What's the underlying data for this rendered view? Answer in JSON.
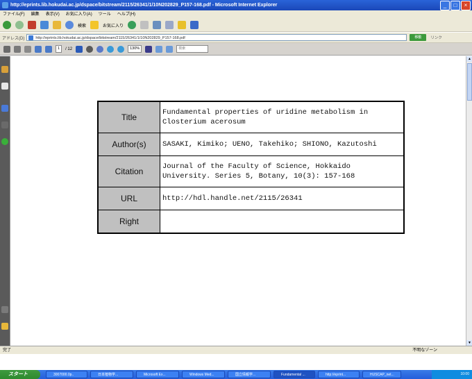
{
  "window": {
    "title": "http://eprints.lib.hokudai.ac.jp/dspace/bitstream/2115/26341/1/10N202829_P157-168.pdf - Microsoft Internet Explorer"
  },
  "menu": [
    "ファイル(F)",
    "編集",
    "表示(V)",
    "お気に入り(A)",
    "ツール",
    "ヘルプ(H)"
  ],
  "toolbar": {
    "search_label": "検索",
    "favorites_label": "お気に入り"
  },
  "address": {
    "label": "アドレス(D)",
    "url": "http://eprints.lib.hokudai.ac.jp/dspace/bitstream/2115/26341/1/10N202829_P157-168.pdf",
    "go_label": "移動",
    "links_label": "リンク"
  },
  "pdf_toolbar": {
    "page_current": "1",
    "page_total": "/ 12",
    "zoom": "130%",
    "find_placeholder": "検索"
  },
  "metadata": [
    {
      "label": "Title",
      "value": "Fundamental properties of uridine metabolism in Closterium acerosum"
    },
    {
      "label": "Author(s)",
      "value": "SASAKI, Kimiko; UENO, Takehiko; SHIONO, Kazutoshi"
    },
    {
      "label": "Citation",
      "value": "Journal of the Faculty of Science, Hokkaido University. Series 5, Botany, 10(3): 157-168"
    },
    {
      "label": "URL",
      "value": "http://hdl.handle.net/2115/26341"
    },
    {
      "label": "Right",
      "value": ""
    }
  ],
  "status": {
    "left": "完了",
    "right": "不明なゾーン"
  },
  "taskbar": {
    "start_label": "スタート",
    "tasks": [
      "3007000.0p..",
      "日本植物学...",
      "Microsoft Ex...",
      "Windows Med...",
      "国立情報学...",
      "Fundamental ...",
      "http://eprint...",
      "HUSCAP_net..."
    ],
    "clock": "10:00"
  }
}
